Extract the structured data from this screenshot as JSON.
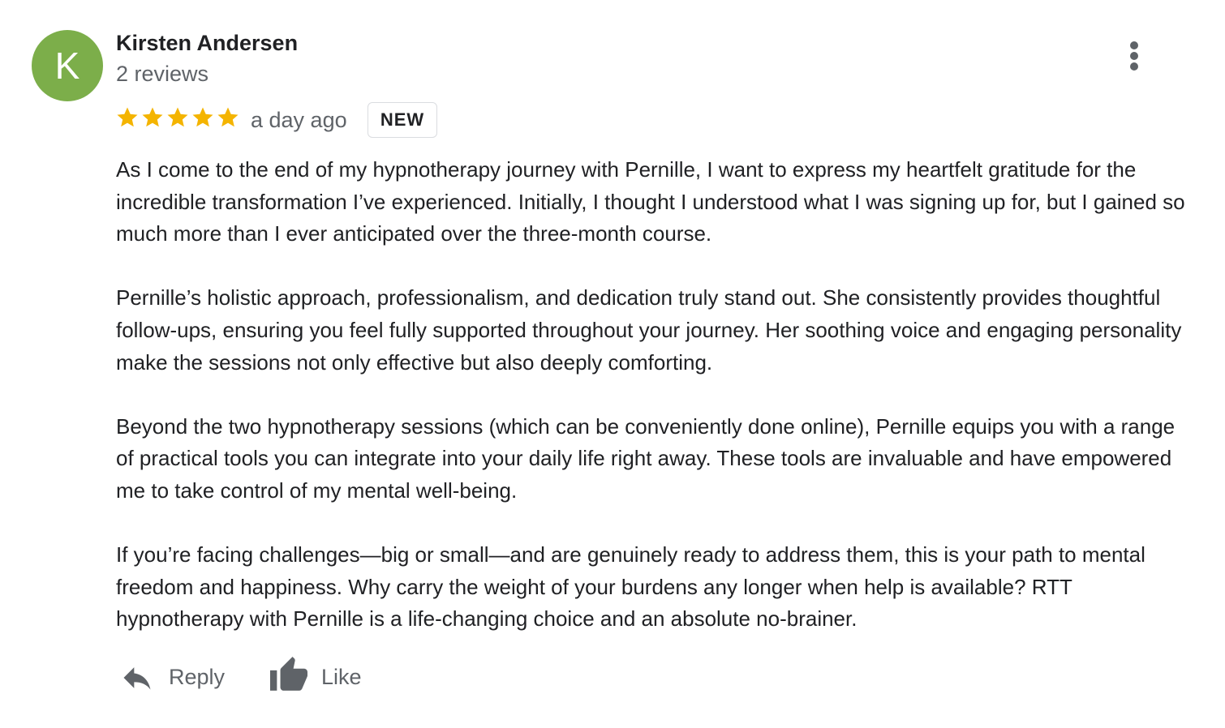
{
  "review": {
    "author": {
      "initial": "K",
      "name": "Kirsten Andersen",
      "review_count": "2 reviews",
      "avatar_color": "#7cae4a"
    },
    "rating": 5,
    "rating_max": 5,
    "star_color": "#f4b400",
    "time_ago": "a day ago",
    "badge": "NEW",
    "paragraphs": [
      "As I come to the end of my hypnotherapy journey with Pernille, I want to express my heartfelt gratitude for the incredible transformation I’ve experienced. Initially, I thought I understood what I was signing up for, but I gained so much more than I ever anticipated over the three-month course.",
      "Pernille’s holistic approach, professionalism, and dedication truly stand out. She consistently provides thoughtful follow-ups, ensuring you feel fully supported throughout your journey. Her soothing voice and engaging personality make the sessions not only effective but also deeply comforting.",
      "Beyond the two hypnotherapy sessions (which can be conveniently done online), Pernille equips you with a range of practical tools you can integrate into your daily life right away. These tools are invaluable and have empowered me to take control of my mental well-being.",
      "If you’re facing challenges—big or small—and are genuinely ready to address them, this is your path to mental freedom and happiness. Why carry the weight of your burdens any longer when help is available? RTT hypnotherapy with Pernille is a life-changing choice and an absolute no-brainer."
    ],
    "actions": {
      "reply_label": "Reply",
      "like_label": "Like"
    },
    "icons": {
      "more": "more-vert-icon",
      "reply": "reply-icon",
      "like": "thumbs-up-icon",
      "star": "star-icon"
    }
  }
}
